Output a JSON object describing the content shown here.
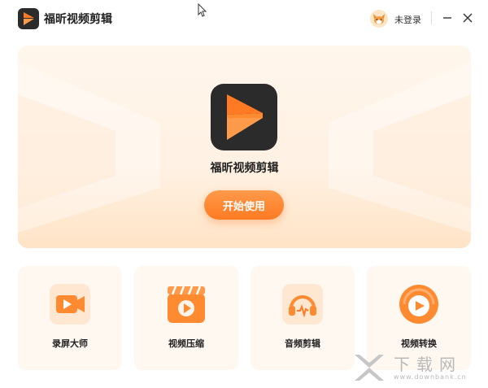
{
  "app": {
    "title": "福昕视频剪辑",
    "brand_color": "#ff7a22",
    "logo_bg": "#2b2b2b"
  },
  "titlebar": {
    "login_label": "未登录",
    "avatar_icon": "fox-avatar-icon",
    "minimize_icon": "minimize-icon",
    "close_icon": "close-icon"
  },
  "hero": {
    "title": "福昕视频剪辑",
    "start_button": "开始使用"
  },
  "tools": [
    {
      "label": "录屏大师",
      "icon": "screen-record-icon"
    },
    {
      "label": "视频压缩",
      "icon": "video-compress-icon"
    },
    {
      "label": "音频剪辑",
      "icon": "audio-edit-icon"
    },
    {
      "label": "视频转换",
      "icon": "video-convert-icon"
    }
  ],
  "watermark": {
    "text": "下载网",
    "url": "www.downbank.cn"
  }
}
